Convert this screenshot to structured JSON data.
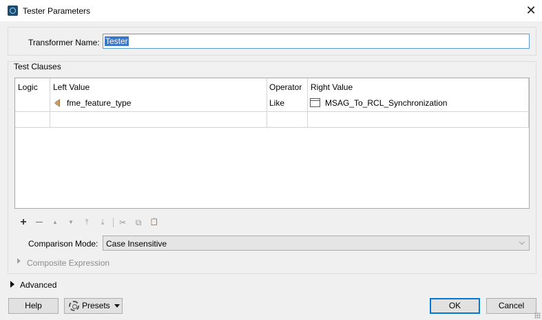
{
  "window": {
    "title": "Tester Parameters",
    "close_glyph": "✕"
  },
  "transformer": {
    "label": "Transformer Name:",
    "value": "Tester"
  },
  "test_clauses": {
    "group_label": "Test Clauses",
    "columns": [
      "Logic",
      "Left Value",
      "Operator",
      "Right Value"
    ],
    "rows": [
      {
        "logic": "",
        "left_value": "fme_feature_type",
        "left_icon": "attribute-icon",
        "operator": "Like",
        "right_value": "MSAG_To_RCL_Synchronization",
        "right_icon": "window-icon"
      },
      {
        "logic": "",
        "left_value": "",
        "operator": "",
        "right_value": ""
      }
    ]
  },
  "toolbar": {
    "icons": [
      "plus-icon",
      "minus-icon",
      "move-up-icon",
      "move-down-icon",
      "move-top-icon",
      "move-bottom-icon",
      "cut-icon",
      "copy-icon",
      "paste-icon"
    ],
    "glyphs": {
      "add": "+",
      "remove": "—",
      "up": "▲",
      "down": "▼",
      "top": "⤒",
      "bottom": "⤓",
      "cut": "✂",
      "copy": "⧉",
      "paste": "📋"
    }
  },
  "comparison": {
    "label": "Comparison Mode:",
    "value": "Case Insensitive",
    "chevron": "⌵"
  },
  "composite": {
    "label": "Composite Expression"
  },
  "advanced": {
    "label": "Advanced"
  },
  "buttons": {
    "help": "Help",
    "presets": "Presets",
    "ok": "OK",
    "cancel": "Cancel"
  },
  "colors": {
    "selection": "#3b78c8",
    "focus_border": "#0078d7"
  }
}
